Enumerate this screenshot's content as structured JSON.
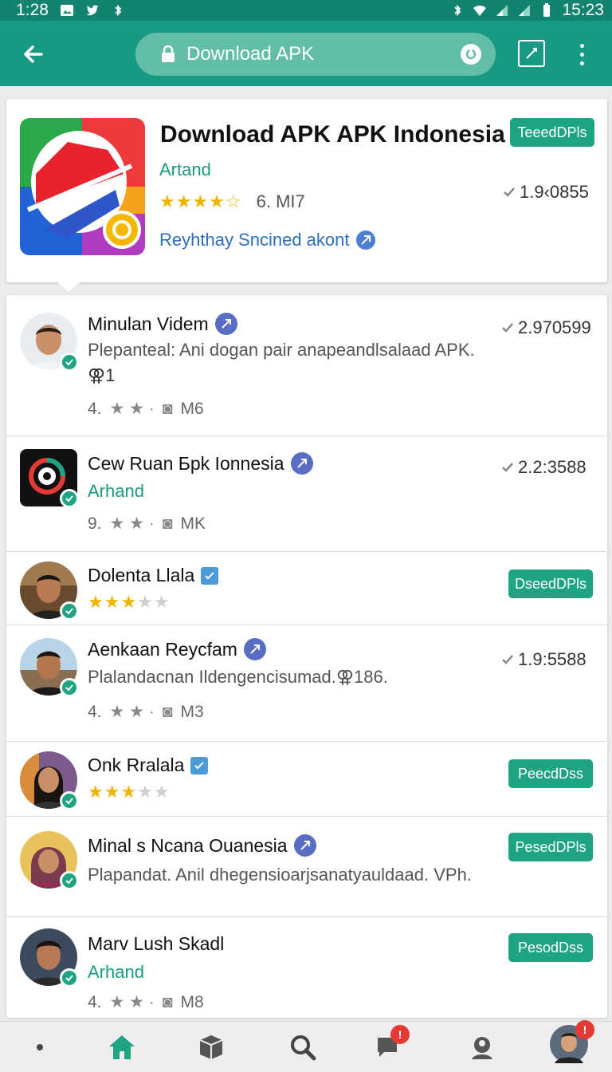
{
  "status_bar": {
    "time_left": "1:28",
    "time_right": "15:23"
  },
  "app_bar": {
    "url": "Download APK"
  },
  "featured": {
    "title": "Download APK APK Indonesia",
    "author": "Artand",
    "rating_stars": 3.5,
    "rating_value": "6. MI7",
    "subtitle": "Reyhthay Sncined akont",
    "button": "TeeedDPls",
    "downloads": "1.9‹0855"
  },
  "list": [
    {
      "title": "Minulan Videm",
      "desc": "Plepanteal: Ani dogan pair anapeandlsalaad APK.",
      "extra": "⚢1",
      "meta_num": "4.",
      "meta_size": "M6",
      "count": "2.970599",
      "avatar_style": "man1"
    },
    {
      "title": "Cew Ruan Бpk Ionnesia",
      "author": "Arhand",
      "meta_num": "9.",
      "meta_size": "MK",
      "count": "2.2:3588",
      "avatar_style": "app"
    },
    {
      "title": "Dolenta Llala",
      "stars": 3,
      "button": "DseedDPls",
      "avatar_style": "man2"
    },
    {
      "title": "Aenkaan Reycfam",
      "desc": "Plalandacnan Ildengencisumad.⚢186.",
      "meta_num": "4.",
      "meta_size": "M3",
      "count": "1.9:5588",
      "avatar_style": "man3"
    },
    {
      "title": "Onk Rralala",
      "stars": 3,
      "button": "PeecdDss",
      "avatar_style": "woman1"
    },
    {
      "title": "Minal s Ncana Ouanesia",
      "desc": "Plapandat. Anil dhegensioarjsanatyauldaad. VPh.",
      "button": "PesedDPls",
      "avatar_style": "woman2"
    },
    {
      "title": "Marv Lush Skadl",
      "author": "Arhand",
      "meta_num": "4.",
      "meta_size": "M8",
      "button": "PesodDss",
      "avatar_style": "man4"
    }
  ],
  "bottom_nav": {
    "items": [
      "dot",
      "home-icon",
      "box-icon",
      "search-icon",
      "chat-icon",
      "profile-pin-icon",
      "user-avatar"
    ],
    "chat_badge": "!",
    "avatar_badge": "!"
  },
  "colors": {
    "primary": "#179983",
    "accent": "#1ea383",
    "star": "#f0b400",
    "link": "#2c6fbf"
  }
}
